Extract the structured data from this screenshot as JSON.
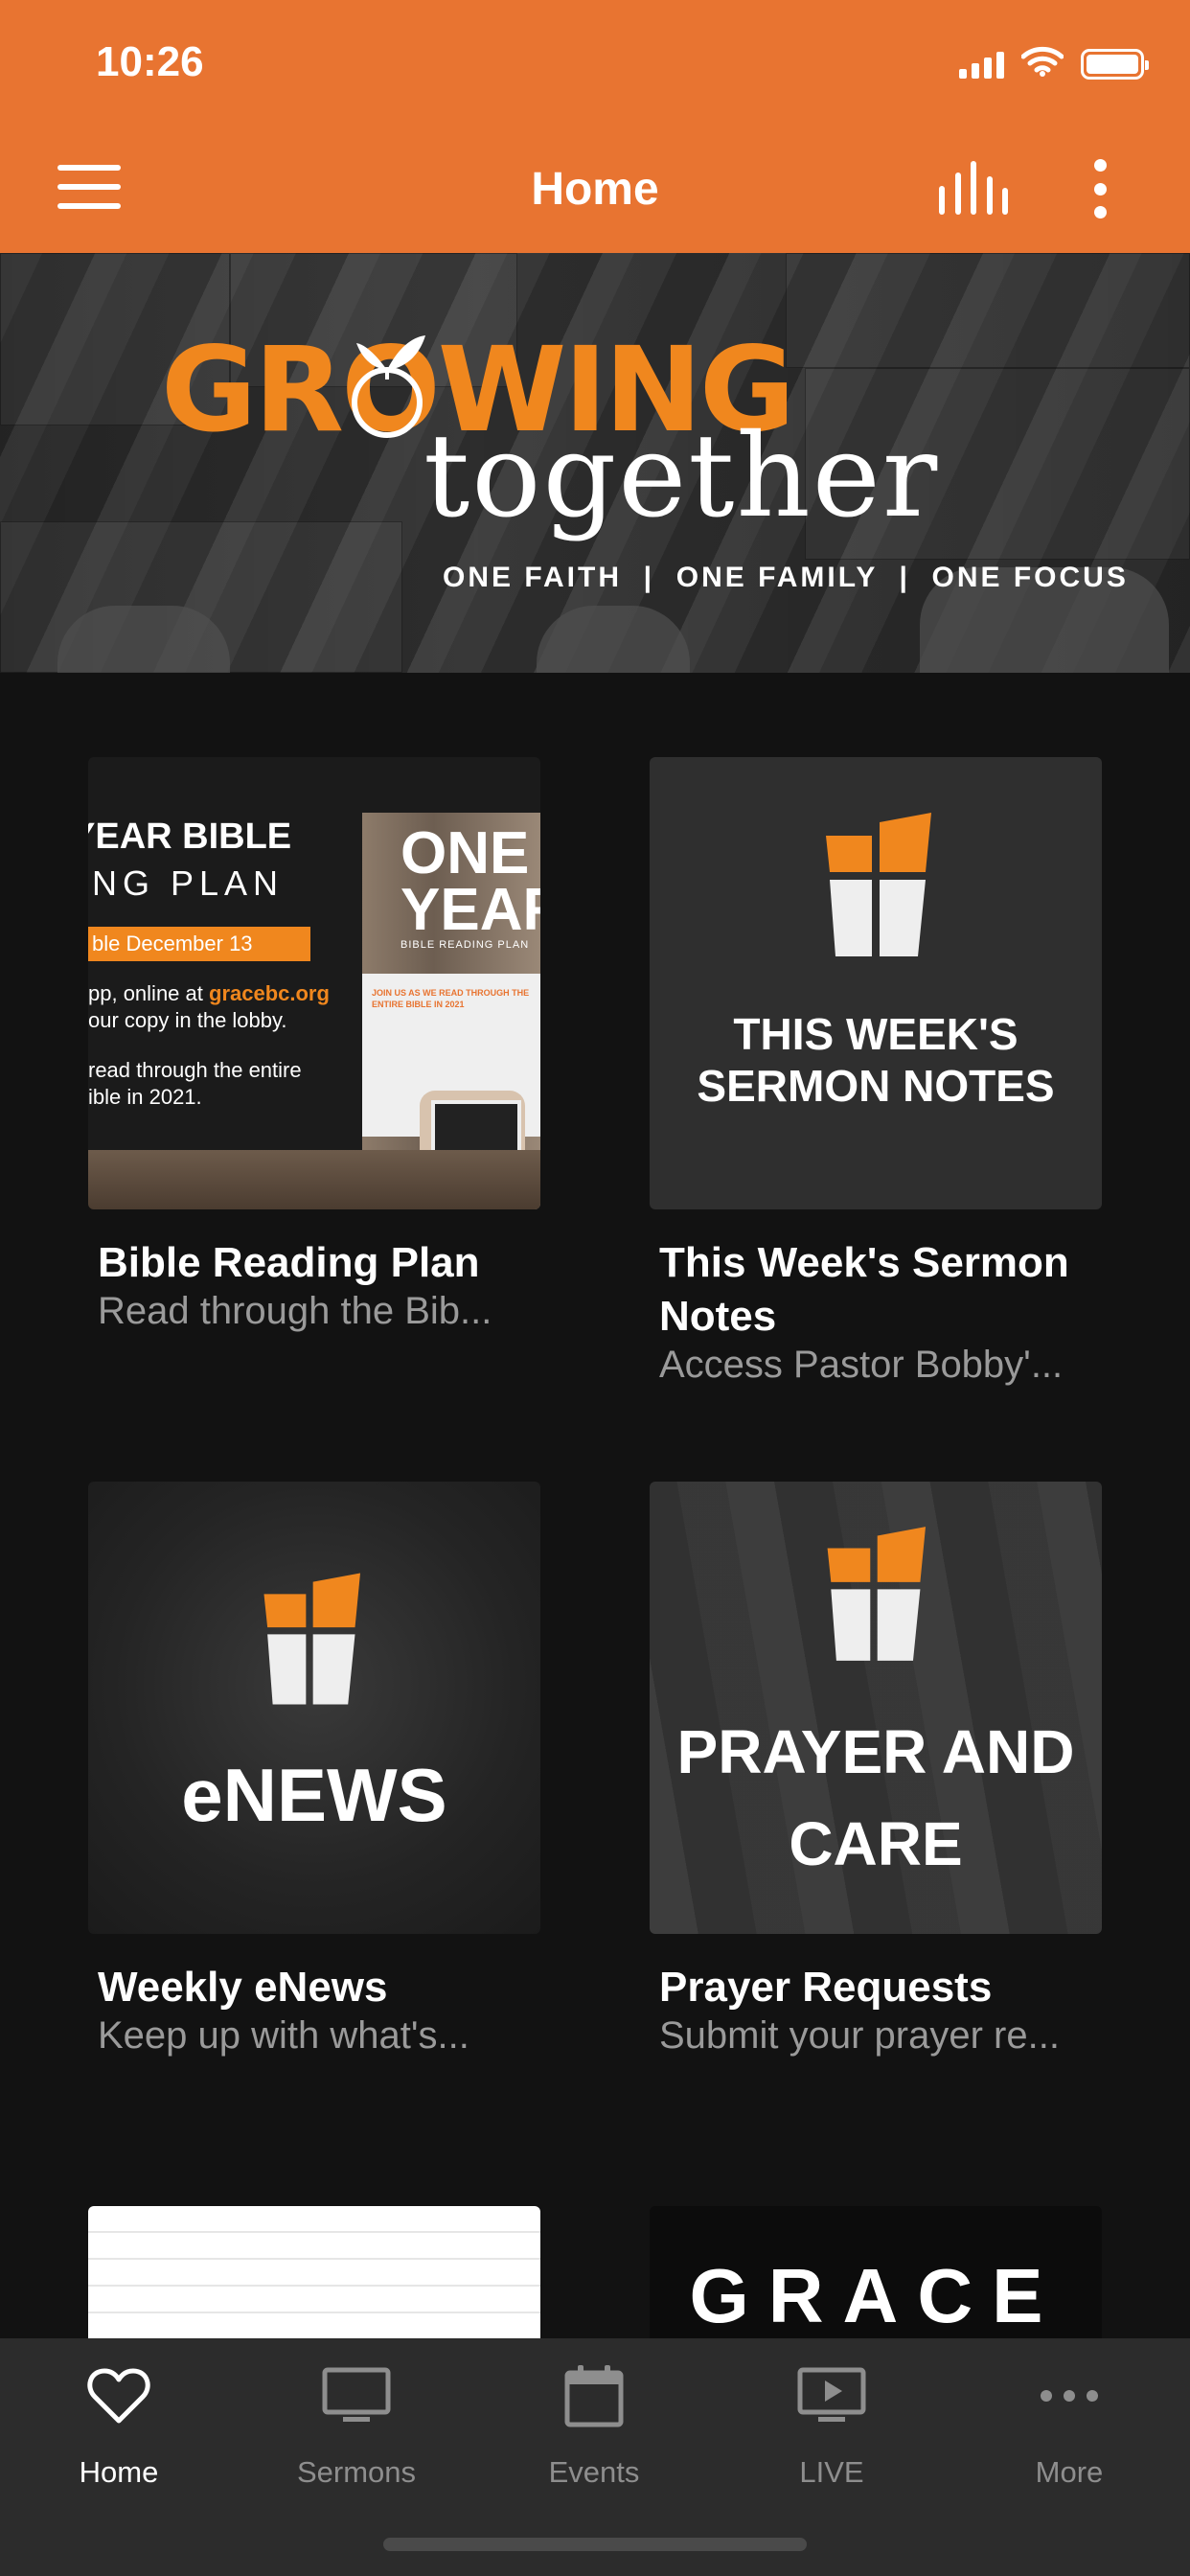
{
  "status_bar": {
    "time": "10:26"
  },
  "nav": {
    "title": "Home"
  },
  "banner": {
    "title_part1": "GROWING",
    "title_part2": "together",
    "tagline": "ONE FAITH  |  ONE FAMILY  |  ONE FOCUS"
  },
  "cards": [
    {
      "title": "Bible Reading Plan",
      "subtitle": "Read through the Bib...",
      "thumb": {
        "line1": "YEAR BIBLE",
        "line2": "ING PLAN",
        "pill": "ble December 13",
        "text_a": "pp, online at",
        "link": "gracebc.org",
        "text_b": "our copy in the lobby.",
        "text_c": "read through the entire",
        "text_d": "ible in 2021.",
        "book_title_1": "ONE",
        "book_title_2": "YEAR",
        "book_subtitle": "BIBLE READING PLAN",
        "book_note": "JOIN US AS WE READ THROUGH THE ENTIRE BIBLE IN 2021"
      }
    },
    {
      "title": "This Week's Sermon Notes",
      "subtitle": "Access Pastor Bobby'...",
      "thumb": {
        "caption": "THIS WEEK'S SERMON NOTES"
      }
    },
    {
      "title": "Weekly eNews",
      "subtitle": "Keep up with what's...",
      "thumb": {
        "caption": "eNEWS"
      }
    },
    {
      "title": "Prayer Requests",
      "subtitle": "Submit your prayer re...",
      "thumb": {
        "caption": "PRAYER AND CARE"
      }
    },
    {
      "thumb": {}
    },
    {
      "thumb": {
        "caption": "GRACE"
      }
    }
  ],
  "tabs": [
    {
      "label": "Home",
      "icon": "heart-icon",
      "active": true
    },
    {
      "label": "Sermons",
      "icon": "monitor-icon"
    },
    {
      "label": "Events",
      "icon": "calendar-icon"
    },
    {
      "label": "LIVE",
      "icon": "play-screen-icon"
    },
    {
      "label": "More",
      "icon": "more-dots-icon"
    }
  ],
  "colors": {
    "header": "#E87431",
    "brand_orange": "#F0871E",
    "background": "#121212",
    "tabbar": "#2c2c2c",
    "subtitle_gray": "#9a9a9a"
  }
}
